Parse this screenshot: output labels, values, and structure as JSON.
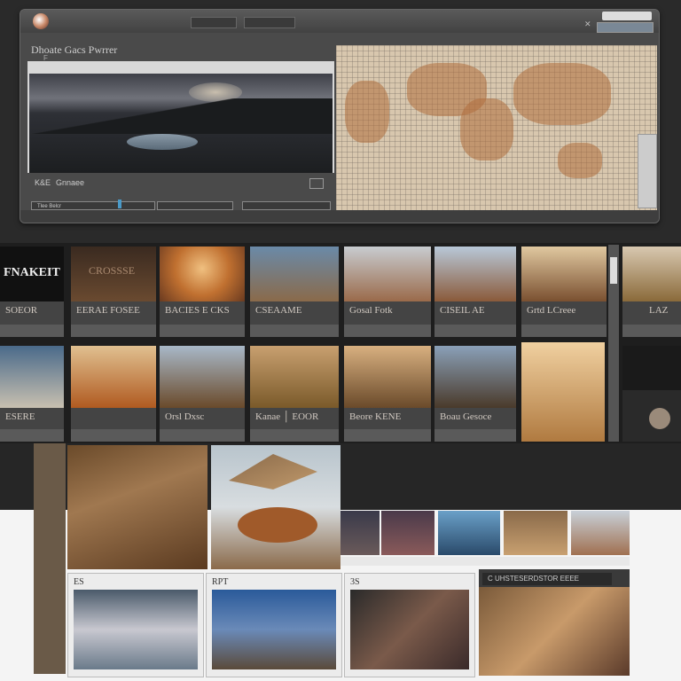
{
  "window": {
    "title": "Dhoate Gacs Pwrrer",
    "subtitle": "F",
    "tabs": [
      "",
      ""
    ],
    "info_line": "",
    "status_right": ""
  },
  "preview": {
    "controls": [
      "K&E",
      "Gnnaee",
      "",
      ""
    ],
    "seek_label": "Tlee  Belcr",
    "mid_field": "",
    "right_field": ""
  },
  "grid": {
    "tiles": [
      {
        "caption": "FNAKEIT",
        "sub": "SOEOR"
      },
      {
        "caption": "CROSSSE",
        "sub": "EERAE FOSEE"
      },
      {
        "caption": "",
        "sub": "BACIES E CKS"
      },
      {
        "caption": "",
        "sub": "CSEAAME"
      },
      {
        "caption": "",
        "sub": "Gosal Fotk"
      },
      {
        "caption": "",
        "sub": "CISEIL AE"
      },
      {
        "caption": "",
        "sub": "Grtd LCreee"
      },
      {
        "caption": "",
        "sub": "LAZ"
      },
      {
        "caption": "",
        "sub": "ESERE"
      },
      {
        "caption": "",
        "sub": ""
      },
      {
        "caption": "",
        "sub": "Orsl Dxsc"
      },
      {
        "caption": "",
        "sub": "Kanae │ EOOR"
      },
      {
        "caption": "",
        "sub": "Beore KENE"
      },
      {
        "caption": "",
        "sub": "Boau Gesoce"
      },
      {
        "caption": "",
        "sub": ""
      },
      {
        "caption": "",
        "sub": ""
      }
    ]
  },
  "bottom": {
    "cards": [
      "ES",
      "RPT",
      "3S"
    ],
    "wide_card_header": "C UHSTESERDSTOR EEEE"
  }
}
